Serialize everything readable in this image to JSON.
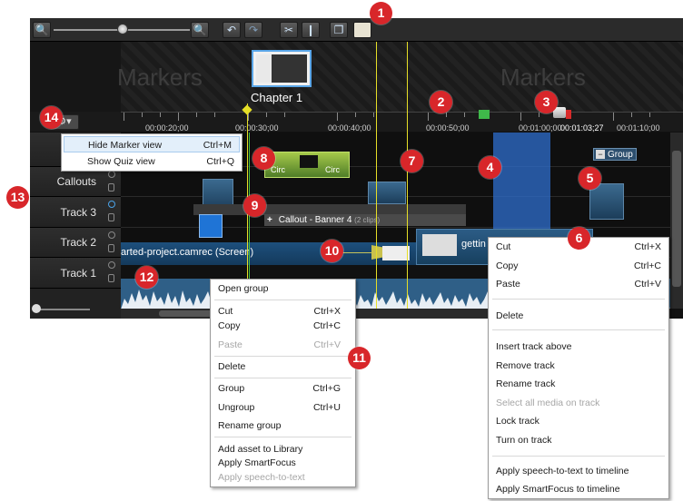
{
  "timeline": {
    "marker_watermark_left": "Markers",
    "marker_watermark_right": "Markers",
    "chapter_label": "Chapter 1",
    "ruler_labels": [
      "00:00:20;00",
      "00:00:30;00",
      "00:00:40;00",
      "00:00:50;00",
      "00:01:00;00",
      "00:01:03;27",
      "00:01:10;00"
    ],
    "tracks": [
      {
        "label": "Callouts"
      },
      {
        "label": "Track 3"
      },
      {
        "label": "Track 2"
      },
      {
        "label": "Track 1"
      }
    ],
    "group_label": "Group",
    "callout_label": "Callout - Banner 4",
    "callout_clips": "(2 clips)",
    "screen_clip_label": "arted-project.camrec (Screen)",
    "clip_getting_label": "gettin",
    "circ_label_1": "Circ",
    "circ_label_2": "Circ"
  },
  "gear_menu": {
    "items": [
      {
        "label": "Hide Marker view",
        "shortcut": "Ctrl+M"
      },
      {
        "label": "Show Quiz view",
        "shortcut": "Ctrl+Q"
      }
    ]
  },
  "group_menu": {
    "open_group": "Open group",
    "cut": "Cut",
    "cut_sc": "Ctrl+X",
    "copy": "Copy",
    "copy_sc": "Ctrl+C",
    "paste": "Paste",
    "paste_sc": "Ctrl+V",
    "delete": "Delete",
    "group": "Group",
    "group_sc": "Ctrl+G",
    "ungroup": "Ungroup",
    "ungroup_sc": "Ctrl+U",
    "rename_group": "Rename group",
    "add_asset": "Add asset to Library",
    "apply_smartfocus": "Apply SmartFocus",
    "apply_speech": "Apply speech-to-text"
  },
  "track_menu": {
    "cut": "Cut",
    "cut_sc": "Ctrl+X",
    "copy": "Copy",
    "copy_sc": "Ctrl+C",
    "paste": "Paste",
    "paste_sc": "Ctrl+V",
    "delete": "Delete",
    "insert_above": "Insert track above",
    "remove_track": "Remove track",
    "rename_track": "Rename track",
    "select_all": "Select all media on track",
    "lock_track": "Lock track",
    "turn_on": "Turn on track",
    "apply_speech": "Apply speech-to-text to timeline",
    "apply_smartfocus": "Apply SmartFocus to timeline"
  },
  "badges": [
    "1",
    "2",
    "3",
    "4",
    "5",
    "6",
    "7",
    "8",
    "9",
    "10",
    "11",
    "12",
    "13",
    "14"
  ],
  "colors": {
    "badge": "#d8262a",
    "playhead_yellow": "#e6df27",
    "selection_blue": "#2f6fcf",
    "wave": "#2f5f87"
  }
}
